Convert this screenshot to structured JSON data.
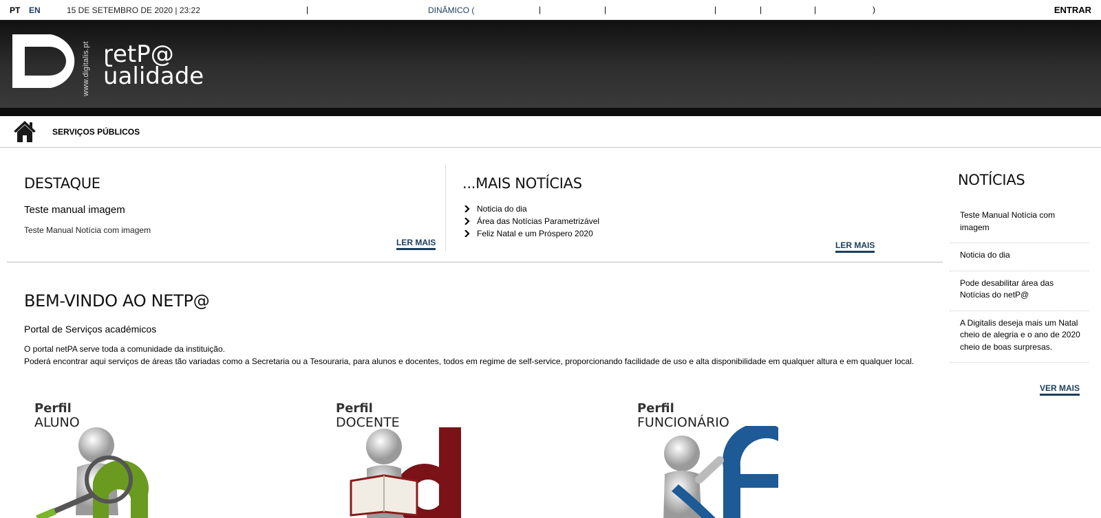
{
  "topbar": {
    "lang_pt": "PT",
    "lang_en": "EN",
    "datetime": "15 DE SETEMBRO DE 2020 | 23:22",
    "separator": "|",
    "dynamic_label": "DINÂMICO (",
    "close_paren": ")",
    "login_label": "ENTRAR"
  },
  "header": {
    "url": "www.digitalis.pt",
    "brand_line1": "ɽetP@",
    "brand_line2": "ualidade"
  },
  "nav": {
    "home_icon": "home-icon",
    "item_label": "SERVIÇOS PÚBLICOS"
  },
  "destaque": {
    "title": "DESTAQUE",
    "subtitle": "Teste manual imagem",
    "text": "Teste Manual Notícia com imagem",
    "read_more": "LER MAIS"
  },
  "mais_noticias": {
    "title": "...MAIS NOTÍCIAS",
    "items": [
      {
        "label": "Noticia do dia"
      },
      {
        "label": "Área das Notícias Parametrizável"
      },
      {
        "label": "Feliz Natal e um Próspero 2020"
      }
    ],
    "read_more": "LER MAIS"
  },
  "welcome": {
    "title": "BEM-VINDO AO NETP@",
    "subtitle": "Portal de Serviços académicos",
    "paragraph1": "O portal netPA serve toda a comunidade da instituição.",
    "paragraph2": "Poderá encontrar aqui serviços de áreas tão variadas como a Secretaria ou a Tesouraria, para alunos e docentes, todos em regime de self-service, proporcionando facilidade de uso e alta disponibilidade em qualquer altura e em qualquer local."
  },
  "news": {
    "title": "NOTÍCIAS",
    "items": [
      {
        "label": "Teste Manual Notícia com imagem"
      },
      {
        "label": "Noticia do dia"
      },
      {
        "label": "Pode desabilitar área das Notícias do netP@"
      },
      {
        "label": "A Digitalis deseja mais um Natal cheio de alegria e o ano de 2020 cheio de boas surpresas."
      }
    ],
    "see_more": "VER MAIS"
  },
  "profiles": [
    {
      "line1": "Perfil",
      "line2": "ALUNO",
      "color": "#6a9a1f"
    },
    {
      "line1": "Perfil",
      "line2": "DOCENTE",
      "color": "#7a1218"
    },
    {
      "line1": "Perfil",
      "line2": "FUNCIONÁRIO",
      "color": "#1d5a96"
    }
  ],
  "colors": {
    "accent": "#1a3d5c",
    "header_dark": "#2e2e2e"
  }
}
